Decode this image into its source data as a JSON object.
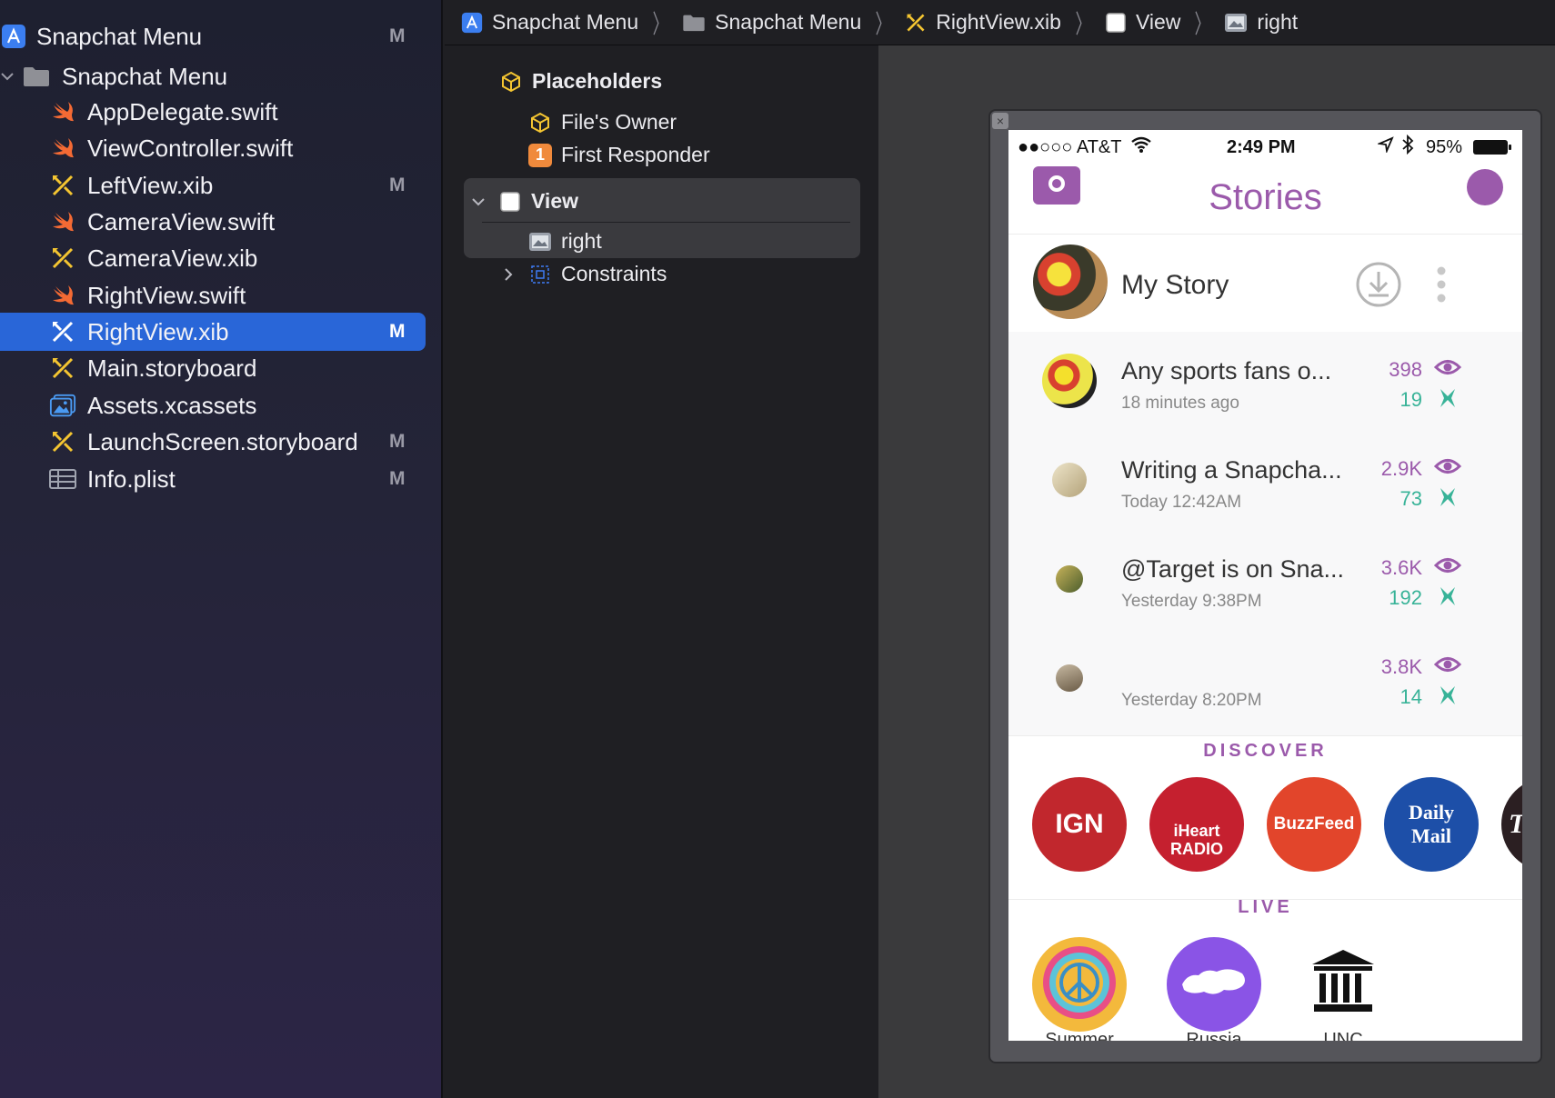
{
  "navigator": {
    "project": {
      "label": "Snapchat Menu",
      "badge": "M"
    },
    "group": {
      "label": "Snapchat Menu"
    },
    "files": [
      {
        "label": "AppDelegate.swift",
        "badge": "",
        "icon": "swift-icon"
      },
      {
        "label": "ViewController.swift",
        "badge": "",
        "icon": "swift-icon"
      },
      {
        "label": "LeftView.xib",
        "badge": "M",
        "icon": "xib-icon"
      },
      {
        "label": "CameraView.swift",
        "badge": "",
        "icon": "swift-icon"
      },
      {
        "label": "CameraView.xib",
        "badge": "",
        "icon": "xib-icon"
      },
      {
        "label": "RightView.swift",
        "badge": "",
        "icon": "swift-icon"
      },
      {
        "label": "RightView.xib",
        "badge": "M",
        "icon": "xib-icon",
        "selected": true
      },
      {
        "label": "Main.storyboard",
        "badge": "",
        "icon": "xib-icon"
      },
      {
        "label": "Assets.xcassets",
        "badge": "",
        "icon": "assets-icon"
      },
      {
        "label": "LaunchScreen.storyboard",
        "badge": "M",
        "icon": "xib-icon"
      },
      {
        "label": "Info.plist",
        "badge": "M",
        "icon": "plist-icon"
      }
    ]
  },
  "breadcrumb": [
    "Snapchat Menu",
    "Snapchat Menu",
    "RightView.xib",
    "View",
    "right"
  ],
  "outline": {
    "placeholders": "Placeholders",
    "files_owner": "File's Owner",
    "first_responder": "First Responder",
    "first_responder_badge": "1",
    "view": "View",
    "right": "right",
    "constraints": "Constraints"
  },
  "phone": {
    "status": {
      "carrier": "●●○○○ AT&T",
      "time": "2:49 PM",
      "battery": "95%"
    },
    "title": "Stories",
    "my_story": "My Story",
    "stories": [
      {
        "title": "Any sports fans o...",
        "time": "18 minutes ago",
        "views": "398",
        "screenshots": "19"
      },
      {
        "title": "Writing a Snapcha...",
        "time": "Today 12:42AM",
        "views": "2.9K",
        "screenshots": "73"
      },
      {
        "title": "@Target is on Sna...",
        "time": "Yesterday 9:38PM",
        "views": "3.6K",
        "screenshots": "192"
      },
      {
        "title": "",
        "time": "Yesterday 8:20PM",
        "views": "3.8K",
        "screenshots": "14"
      }
    ],
    "discover_label": "DISCOVER",
    "discover": [
      "IGN",
      "iHeart RADIO",
      "BuzzFeed",
      "Daily Mail",
      "T"
    ],
    "live_label": "LIVE",
    "live": [
      "Summer",
      "Russia",
      "UNC"
    ],
    "colors": {
      "accent": "#9b5aab",
      "teal": "#38b398"
    }
  }
}
